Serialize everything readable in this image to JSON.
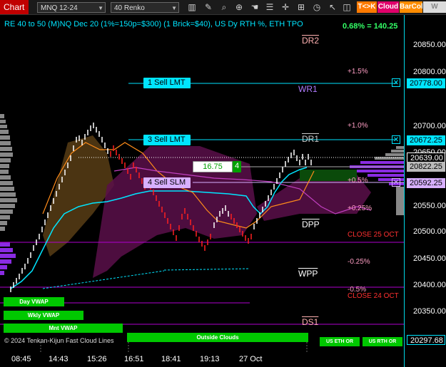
{
  "toolbar": {
    "chart_tab": "Chart",
    "instrument": "MNQ 12-24",
    "period": "40 Renko",
    "icons": [
      "pencil-icon",
      "search-zoom-icon",
      "zoom-icon",
      "hand-icon",
      "list-icon",
      "crosshair-icon",
      "chart-type-icon",
      "clock-icon"
    ],
    "badges": {
      "tck": "T<>K",
      "cloud": "Cloud",
      "barcol": "BarCol",
      "wvwa": "W VWA"
    }
  },
  "header": {
    "title": "RE 40 to 50 (M)NQ Dec 20 (1%=150p=$300) (1 Brick=$40), US Dy RTH %, ETH TPO",
    "pct_change": "0.68% = 140.25"
  },
  "y_axis": {
    "labels": [
      "20850.00",
      "20800.00",
      "20700.00",
      "20650.00",
      "20550.00",
      "20500.00",
      "20450.00",
      "20400.00",
      "20350.00"
    ],
    "flags": [
      {
        "text": "20778.00",
        "bg": "#00e5ff",
        "fg": "#000"
      },
      {
        "text": "20672.25",
        "bg": "#00e5ff",
        "fg": "#000"
      },
      {
        "text": "20639.00",
        "bg": "#000",
        "fg": "#fff"
      },
      {
        "text": "20822.25",
        "bg": "#bbb",
        "fg": "#000"
      },
      {
        "text": "20592.25",
        "bg": "#d8b0ff",
        "fg": "#000"
      },
      {
        "text": "20297.68",
        "bg": "#000",
        "fg": "#fff"
      }
    ],
    "extra_top": "20650.00"
  },
  "x_axis": {
    "labels": [
      "08:45",
      "14:43",
      "15:26",
      "16:51",
      "18:41",
      "19:13",
      "27 Oct"
    ]
  },
  "orders": {
    "sell1": "1 Sell LMT",
    "sell3": "3 Sell LMT",
    "sell4": "4 Sell SLM",
    "pl_value": "16.75",
    "qty": "4"
  },
  "pivots": {
    "dr2": "DR2",
    "wr1": "WR1",
    "dr1": "DR1",
    "dpp": "DPP",
    "wpp": "WPP",
    "ds1": "DS1"
  },
  "pct_levels": [
    "+1.5%",
    "+1.0%",
    "+0.5%",
    "+0.25%",
    "-0.25%",
    "-0.5%"
  ],
  "close_labels": [
    "CLOSE 25 OCT",
    "CLOSE 24 OCT"
  ],
  "vwap": {
    "day": "Day VWAP",
    "wkly": "Wkly VWAP",
    "mnt": "Mnt VWAP",
    "outside": "Outside Clouds",
    "us_eth": "US ETH OR",
    "us_rth": "US RTH OR"
  },
  "legend": "© 2024 Tenkan-Kijun Fast Cloud Lines",
  "colors": {
    "cyan": "#00e5ff",
    "green": "#00c800",
    "purple": "#b000d0",
    "orange": "#ff8c1a",
    "red": "#ff2020"
  }
}
